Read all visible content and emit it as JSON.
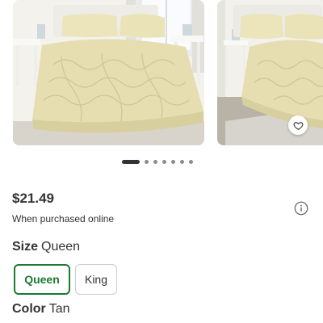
{
  "carousel": {
    "images": [
      {
        "alt": "quilted bedspread on bed"
      },
      {
        "alt": "quilted bedspread side view"
      }
    ],
    "favorite_icon": "heart-outline-icon",
    "dots_count": 7,
    "active_dot": 0
  },
  "price": {
    "amount": "$21.49",
    "note": "When purchased online",
    "info_icon": "info-circle-icon"
  },
  "size": {
    "label": "Size",
    "value": "Queen",
    "options": [
      {
        "label": "Queen",
        "selected": true
      },
      {
        "label": "King",
        "selected": false
      }
    ]
  },
  "color": {
    "label": "Color",
    "value": "Tan"
  },
  "colors": {
    "selected_accent": "#1a7a2e",
    "text": "#333333",
    "bedspread": "#e6ddb0"
  }
}
